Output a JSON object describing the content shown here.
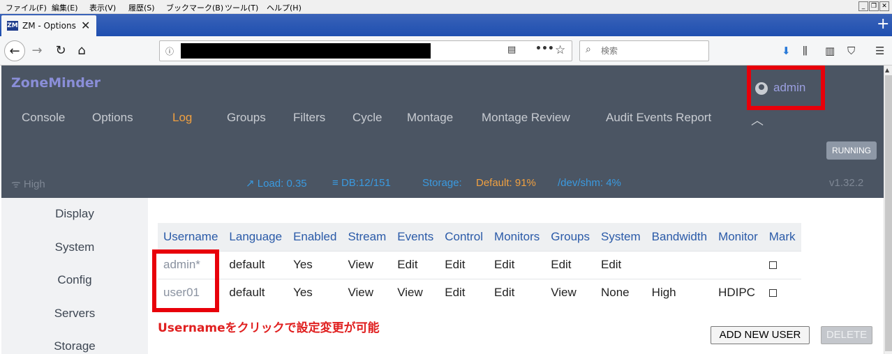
{
  "menubar": {
    "items": [
      "ファイル(F)",
      "編集(E)",
      "表示(V)",
      "履歴(S)",
      "ブックマーク(B)",
      "ツール(T)",
      "ヘルプ(H)"
    ]
  },
  "tab": {
    "favicon": "ZM",
    "title": "ZM - Options"
  },
  "toolbar": {
    "search_placeholder": "検索"
  },
  "zm": {
    "logo": "ZoneMinder",
    "nav": [
      "Console",
      "Options",
      "Log",
      "Groups",
      "Filters",
      "Cycle",
      "Montage",
      "Montage Review",
      "Audit Events Report"
    ],
    "active_nav": "Log",
    "user": "admin",
    "status": "RUNNING",
    "bandwidth": "High",
    "load": "Load: 0.35",
    "db": "DB:12/151",
    "storage_label": "Storage:",
    "storage_default": "Default: 91%",
    "storage_shm": "/dev/shm: 4%",
    "version": "v1.32.2"
  },
  "sidebar": {
    "items": [
      "Display",
      "System",
      "Config",
      "Servers",
      "Storage"
    ]
  },
  "users_table": {
    "headers": [
      "Username",
      "Language",
      "Enabled",
      "Stream",
      "Events",
      "Control",
      "Monitors",
      "Groups",
      "System",
      "Bandwidth",
      "Monitor",
      "Mark"
    ],
    "rows": [
      [
        "admin*",
        "default",
        "Yes",
        "View",
        "Edit",
        "Edit",
        "Edit",
        "Edit",
        "Edit",
        "",
        ""
      ],
      [
        "user01",
        "default",
        "Yes",
        "View",
        "View",
        "Edit",
        "Edit",
        "View",
        "None",
        "High",
        "HDIPC"
      ]
    ]
  },
  "annotation": "Usernameをクリックで設定変更が可能",
  "buttons": {
    "add": "ADD NEW USER",
    "delete": "DELETE"
  },
  "colors": {
    "header_bg": "#4b5563",
    "accent": "#f0a040",
    "highlight": "#e8000a",
    "link": "#2a5aa8"
  }
}
